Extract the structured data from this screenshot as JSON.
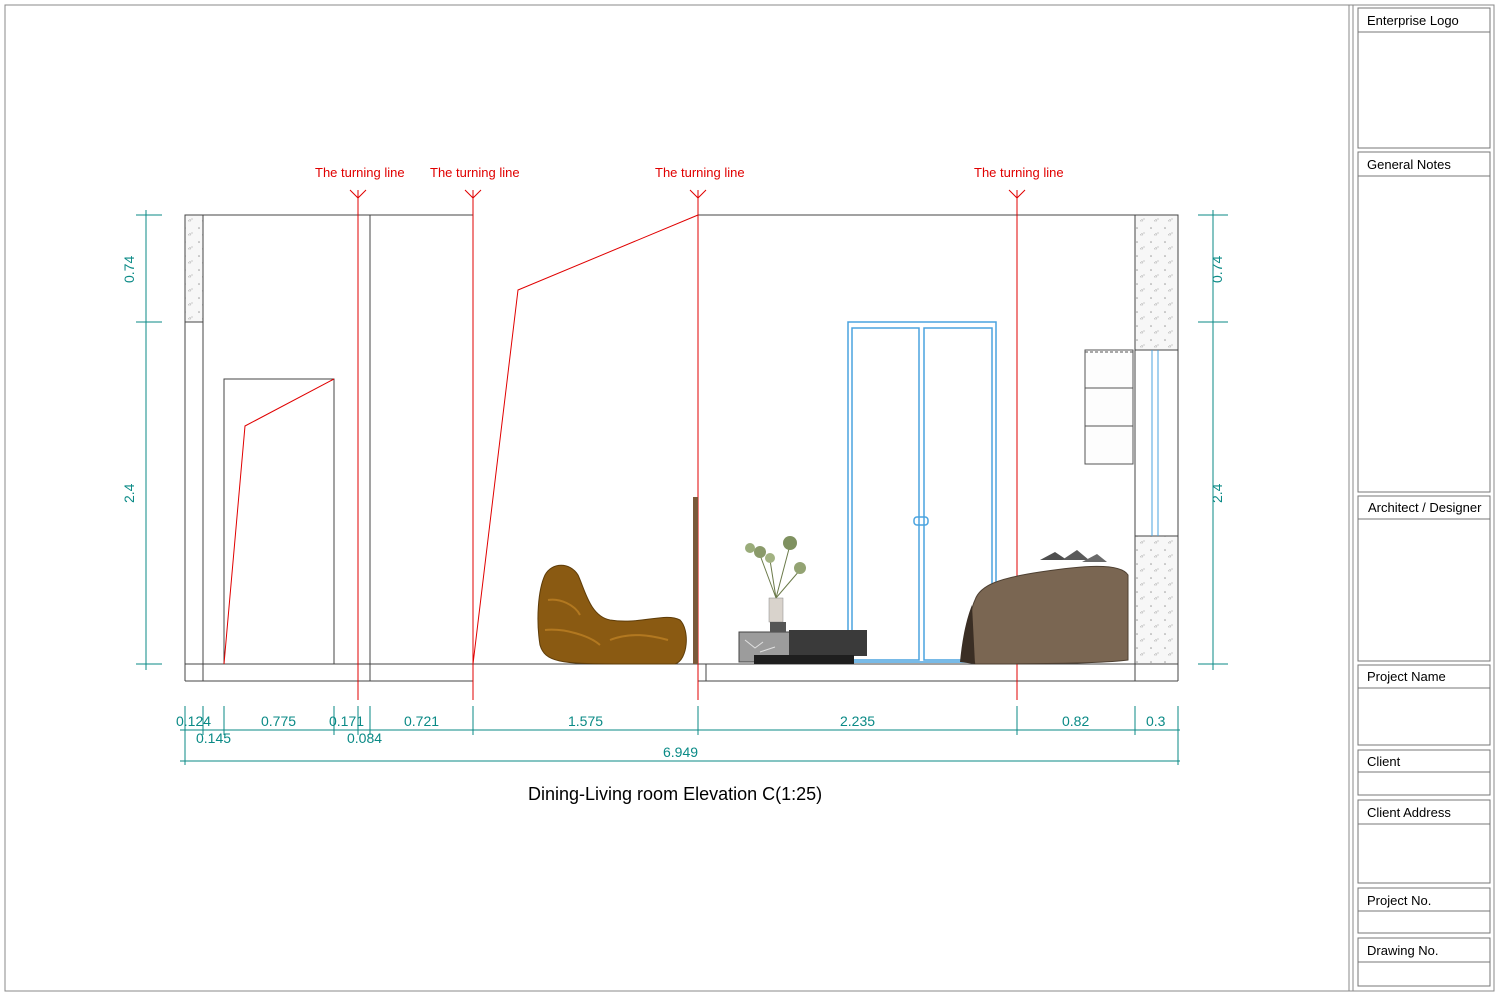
{
  "drawing": {
    "title": "Dining-Living room Elevation C(1:25)",
    "turning_line_label": "The turning line",
    "dimensions": {
      "horizontal_top": [
        "0.124",
        "0.775",
        "0.171",
        "0.721",
        "1.575",
        "2.235",
        "0.82",
        "0.3"
      ],
      "horizontal_sub": [
        "0.145",
        "0.084"
      ],
      "total": "6.949",
      "left_vertical": [
        "0.74",
        "2.4"
      ],
      "right_vertical": [
        "0.74",
        "2.4"
      ]
    }
  },
  "title_block": {
    "enterprise_logo": "Enterprise Logo",
    "general_notes": "General Notes",
    "architect": "Architect / Designer",
    "project_name": "Project Name",
    "client": "Client",
    "client_address": "Client Address",
    "project_no": "Project No.",
    "drawing_no": "Drawing No."
  },
  "colors": {
    "dimension": "#0a8a86",
    "turning_line": "#e00000",
    "door_frame": "#4aa3df",
    "outline": "#333333"
  }
}
